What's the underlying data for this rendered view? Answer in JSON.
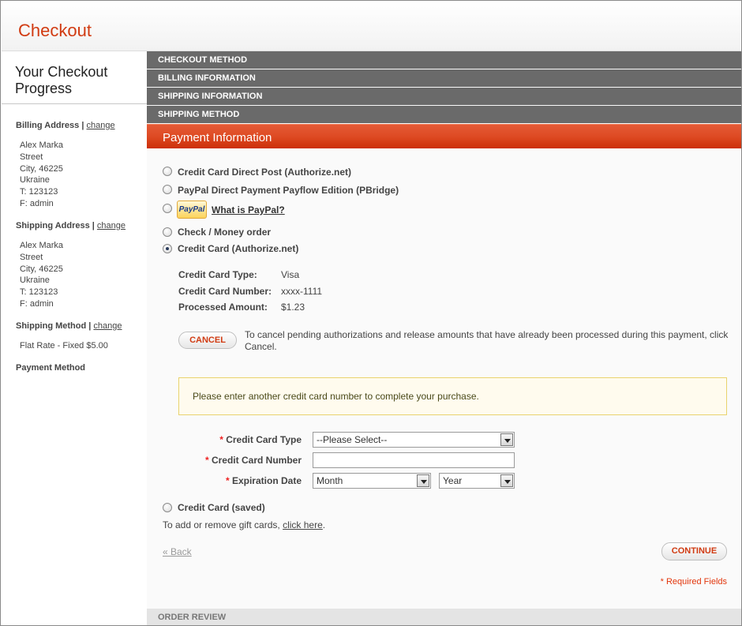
{
  "header": {
    "title": "Checkout"
  },
  "sidebar": {
    "title": "Your Checkout Progress",
    "sections": [
      {
        "heading": "Billing Address",
        "separator": "|",
        "link": "change",
        "lines": [
          "Alex Marka",
          "Street",
          "City, 46225",
          "Ukraine",
          "T: 123123",
          "F: admin"
        ]
      },
      {
        "heading": "Shipping Address",
        "separator": "|",
        "link": "change",
        "lines": [
          "Alex Marka",
          "Street",
          "City, 46225",
          "Ukraine",
          "T: 123123",
          "F: admin"
        ]
      },
      {
        "heading": "Shipping Method",
        "separator": "|",
        "link": "change",
        "lines": [
          "Flat Rate - Fixed $5.00"
        ]
      },
      {
        "heading": "Payment Method"
      }
    ]
  },
  "steps": {
    "checkout_method": "CHECKOUT METHOD",
    "billing_information": "BILLING INFORMATION",
    "shipping_information": "SHIPPING INFORMATION",
    "shipping_method": "SHIPPING METHOD",
    "payment_information": "Payment Information",
    "order_review": "ORDER REVIEW"
  },
  "payment": {
    "options": [
      {
        "label": "Credit Card Direct Post (Authorize.net)",
        "selected": false
      },
      {
        "label": "PayPal Direct Payment Payflow Edition (PBridge)",
        "selected": false
      },
      {
        "label": "What is PayPal?",
        "logo_text": "PayPal",
        "selected": false
      },
      {
        "label": "Check / Money order",
        "selected": false
      },
      {
        "label": "Credit Card (Authorize.net)",
        "selected": true
      },
      {
        "label": "Credit Card (saved)",
        "selected": false
      }
    ],
    "card_details": [
      {
        "label": "Credit Card Type:",
        "value": "Visa"
      },
      {
        "label": "Credit Card Number:",
        "value": "xxxx-1111"
      },
      {
        "label": "Processed Amount:",
        "value": "$1.23"
      }
    ],
    "cancel_button": "CANCEL",
    "cancel_text": "To cancel pending authorizations and release amounts that have already been processed during this payment, click Cancel.",
    "notice": "Please enter another credit card number to complete your purchase.",
    "form": {
      "required_mark": "*",
      "cc_type_label": "Credit Card Type",
      "cc_type_value": "--Please Select--",
      "cc_number_label": "Credit Card Number",
      "cc_number_value": "",
      "expiration_label": "Expiration Date",
      "month_value": "Month",
      "year_value": "Year"
    },
    "gift_text": "To add or remove gift cards,",
    "gift_link": "click here",
    "gift_end": ".",
    "back_link": "« Back",
    "continue_button": "CONTINUE",
    "required_fields": "* Required Fields"
  },
  "colors": {
    "accent": "#d13b12",
    "step_bar": "#6a6a6a",
    "active_step": "#de4a23",
    "notice_border": "#e9d36e"
  }
}
